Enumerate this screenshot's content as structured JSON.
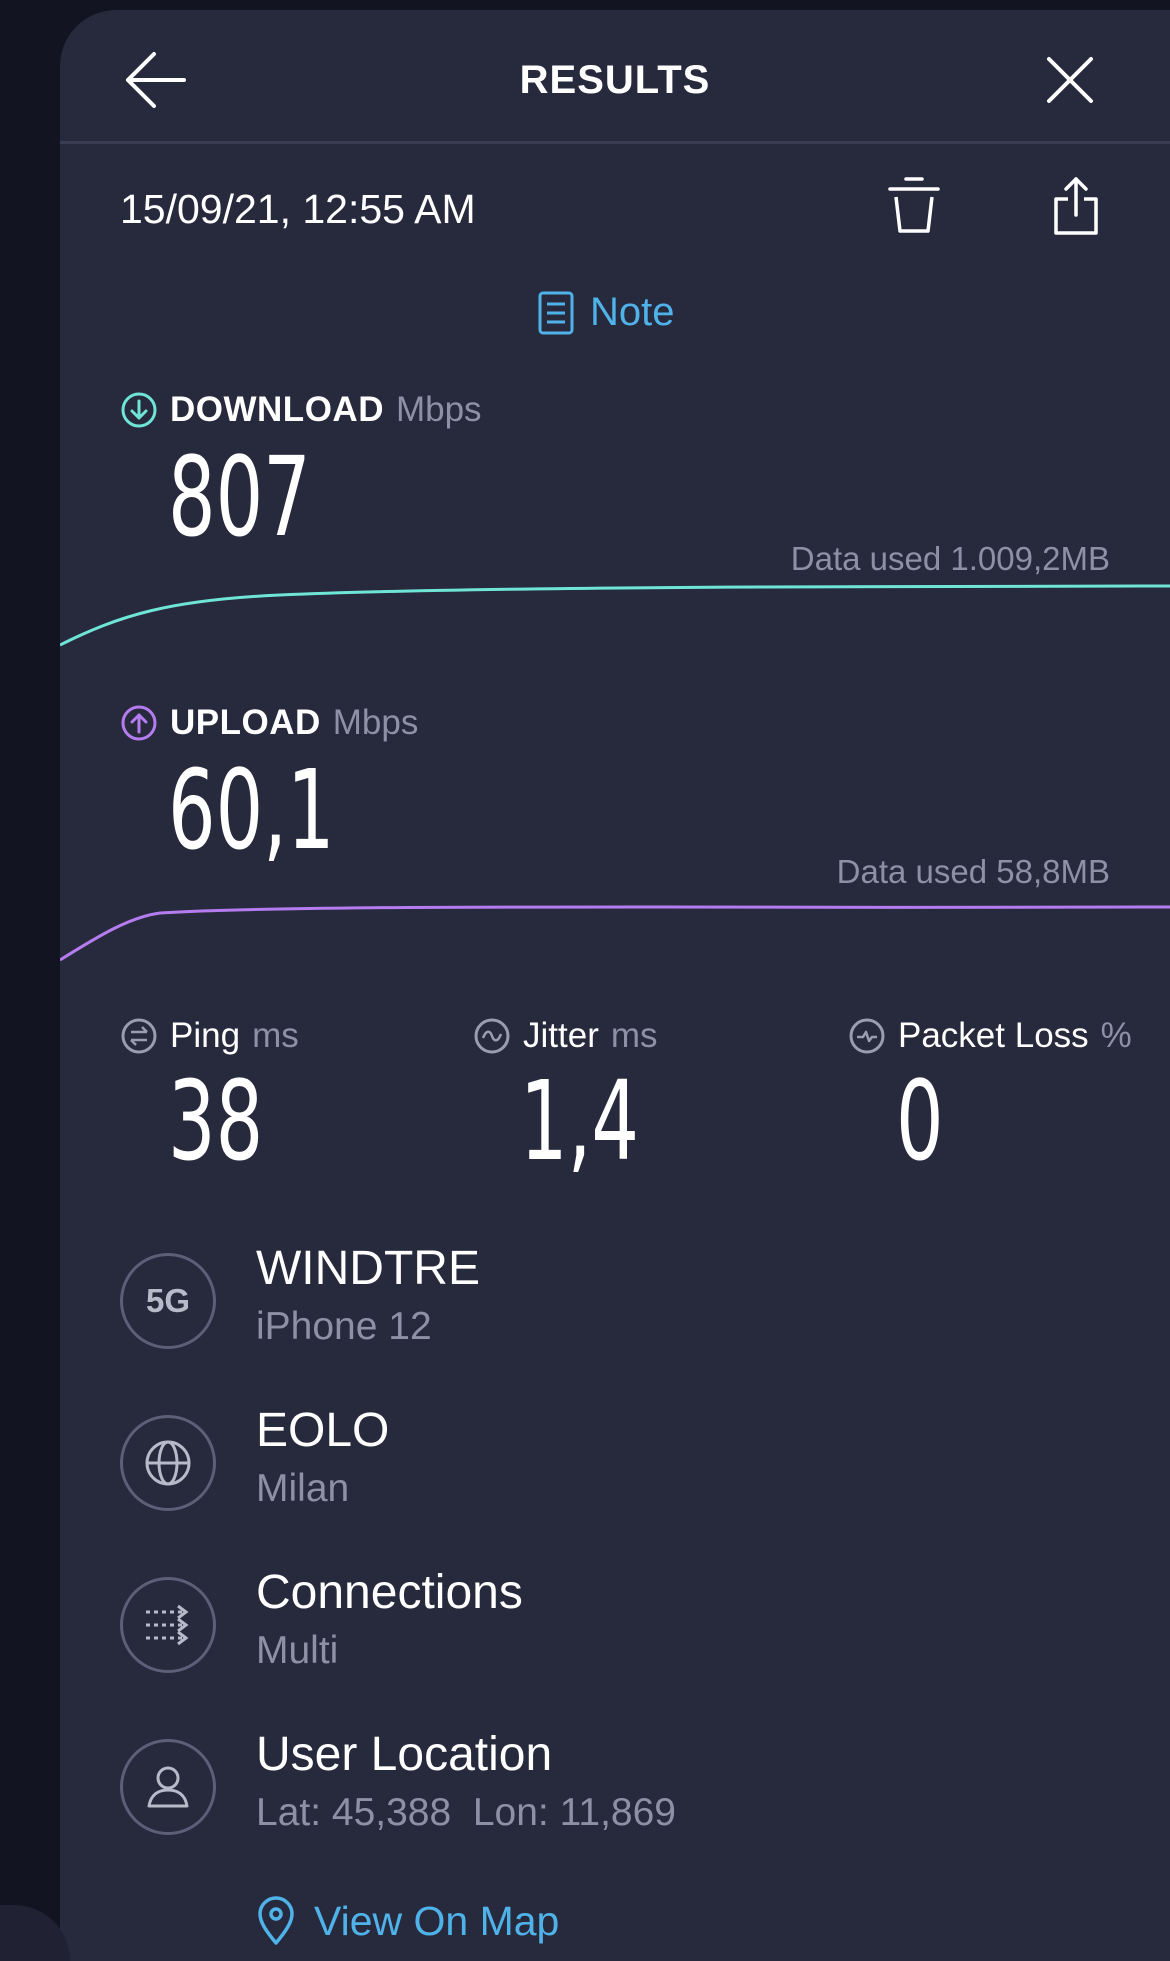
{
  "header": {
    "title": "RESULTS"
  },
  "result": {
    "datetime": "15/09/21, 12:55 AM",
    "note_label": "Note"
  },
  "download": {
    "label": "DOWNLOAD",
    "unit": "Mbps",
    "value": "807",
    "data_used": "Data used 1.009,2MB",
    "color": "#6fe5d8"
  },
  "upload": {
    "label": "UPLOAD",
    "unit": "Mbps",
    "value": "60,1",
    "data_used": "Data used 58,8MB",
    "color": "#b57cf0"
  },
  "ping": {
    "label": "Ping",
    "unit": "ms",
    "value": "38"
  },
  "jitter": {
    "label": "Jitter",
    "unit": "ms",
    "value": "1,4"
  },
  "packet_loss": {
    "label": "Packet Loss",
    "unit": "%",
    "value": "0"
  },
  "network": {
    "badge": "5G",
    "carrier": "WINDTRE",
    "device": "iPhone 12"
  },
  "server": {
    "name": "EOLO",
    "location": "Milan"
  },
  "connections": {
    "title": "Connections",
    "mode": "Multi"
  },
  "user_location": {
    "title": "User Location",
    "coords": "Lat: 45,388  Lon: 11,869",
    "map_link": "View On Map"
  },
  "icons": {
    "back": "arrow-left-icon",
    "close": "close-icon",
    "delete": "trash-icon",
    "share": "share-icon",
    "note": "note-icon",
    "download": "download-icon",
    "upload": "upload-icon",
    "ping": "ping-icon",
    "jitter": "jitter-icon",
    "packet_loss": "packet-loss-icon",
    "server": "globe-icon",
    "connections": "connections-icon",
    "user": "user-icon",
    "map_pin": "map-pin-icon"
  },
  "colors": {
    "background": "#121421",
    "panel": "#272a3c",
    "accent_blue": "#4fb3ea",
    "muted_text": "#8e91a6"
  }
}
